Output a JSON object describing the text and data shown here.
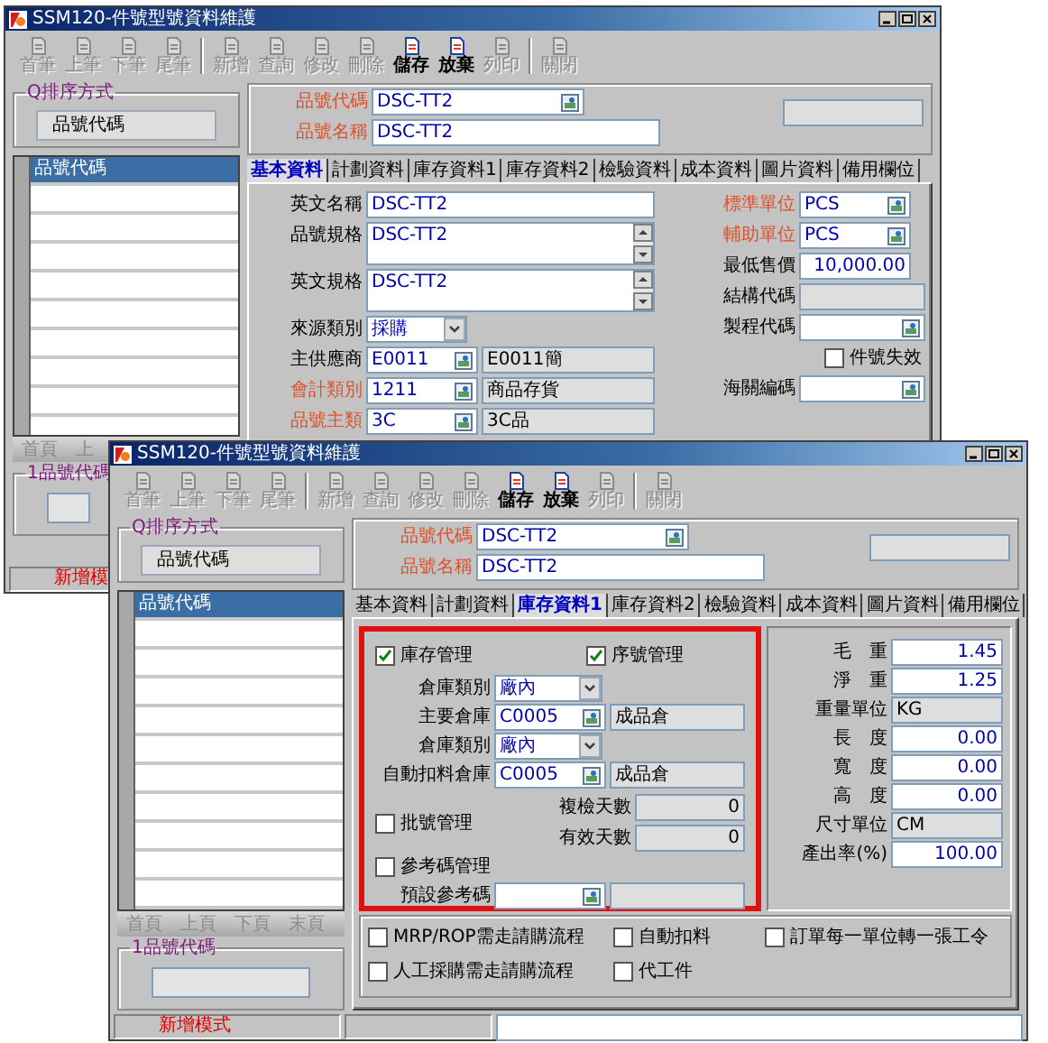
{
  "windows": [
    {
      "title": "SSM120-件號型號資料維護",
      "toolbar": [
        [
          {
            "label": "首筆",
            "disabled": true
          },
          {
            "label": "上筆",
            "disabled": true
          },
          {
            "label": "下筆",
            "disabled": true
          },
          {
            "label": "尾筆",
            "disabled": true
          }
        ],
        [
          {
            "label": "新增",
            "disabled": true
          },
          {
            "label": "查詢",
            "disabled": true
          },
          {
            "label": "修改",
            "disabled": true
          },
          {
            "label": "刪除",
            "disabled": true
          },
          {
            "label": "儲存",
            "disabled": false
          },
          {
            "label": "放棄",
            "disabled": false
          },
          {
            "label": "列印",
            "disabled": true
          }
        ],
        [
          {
            "label": "關閉",
            "disabled": true
          }
        ]
      ],
      "sort_group": {
        "title": "Q排序方式",
        "value": "品號代碼"
      },
      "list_header": "品號代碼",
      "nav": [
        {
          "label": "首頁",
          "disabled": true
        },
        {
          "label": "上",
          "disabled": true
        }
      ],
      "filter_group": {
        "title": "1品號代碼"
      },
      "status_bar": {
        "mode": "新增模"
      },
      "header_fields": [
        {
          "kind": "field",
          "label": "品號代碼",
          "required": true,
          "fields": [
            {
              "kind": "lookup",
              "value": "DSC-TT2"
            }
          ]
        },
        {
          "kind": "field",
          "label": "品號名稱",
          "required": true,
          "fields": [
            {
              "kind": "text",
              "value": "DSC-TT2"
            }
          ]
        }
      ],
      "tabs": [
        {
          "label": "基本資料",
          "selected": true
        },
        {
          "label": "計劃資料",
          "selected": false
        },
        {
          "label": "庫存資料1",
          "selected": false
        },
        {
          "label": "庫存資料2",
          "selected": false
        },
        {
          "label": "檢驗資料",
          "selected": false
        },
        {
          "label": "成本資料",
          "selected": false
        },
        {
          "label": "圖片資料",
          "selected": false
        },
        {
          "label": "備用欄位",
          "selected": false
        }
      ],
      "form": {
        "kind": "basic",
        "left": [
          {
            "kind": "field",
            "label": "英文名稱",
            "required": false,
            "fields": [
              {
                "kind": "text",
                "value": "DSC-TT2"
              }
            ]
          },
          {
            "kind": "field",
            "label": "品號規格",
            "required": false,
            "fields": [
              {
                "kind": "textarea",
                "value": "DSC-TT2"
              }
            ]
          },
          {
            "kind": "field",
            "label": "英文規格",
            "required": false,
            "fields": [
              {
                "kind": "textarea",
                "value": "DSC-TT2"
              }
            ]
          },
          {
            "kind": "field",
            "label": "來源類別",
            "required": false,
            "fields": [
              {
                "kind": "select",
                "value": "採購"
              }
            ]
          },
          {
            "kind": "field",
            "label": "主供應商",
            "required": false,
            "fields": [
              {
                "kind": "lookup",
                "value": "E0011"
              },
              {
                "kind": "readonly",
                "value": "E0011簡"
              }
            ]
          },
          {
            "kind": "field",
            "label": "會計類別",
            "required": true,
            "fields": [
              {
                "kind": "lookup",
                "value": "1211"
              },
              {
                "kind": "readonly",
                "value": "商品存貨"
              }
            ]
          },
          {
            "kind": "field",
            "label": "品號主類",
            "required": true,
            "fields": [
              {
                "kind": "lookup",
                "value": "3C"
              },
              {
                "kind": "readonly",
                "value": "3C品"
              }
            ]
          }
        ],
        "right": [
          {
            "kind": "field",
            "label": "標準單位",
            "required": true,
            "fields": [
              {
                "kind": "lookup",
                "value": "PCS"
              }
            ]
          },
          {
            "kind": "field",
            "label": "輔助單位",
            "required": true,
            "fields": [
              {
                "kind": "lookup",
                "value": "PCS"
              }
            ]
          },
          {
            "kind": "field",
            "label": "最低售價",
            "required": false,
            "fields": [
              {
                "kind": "number",
                "value": "10,000.00"
              }
            ]
          },
          {
            "kind": "field",
            "label": "結構代碼",
            "required": false,
            "fields": [
              {
                "kind": "readonly"
              }
            ]
          },
          {
            "kind": "field",
            "label": "製程代碼",
            "required": false,
            "fields": [
              {
                "kind": "lookup"
              }
            ]
          },
          {
            "kind": "checkbox",
            "label": "件號失效",
            "checked": false
          },
          {
            "kind": "field",
            "label": "海關編碼",
            "required": false,
            "fields": [
              {
                "kind": "lookup"
              }
            ]
          }
        ]
      }
    },
    {
      "title": "SSM120-件號型號資料維護",
      "toolbar": [
        [
          {
            "label": "首筆",
            "disabled": true
          },
          {
            "label": "上筆",
            "disabled": true
          },
          {
            "label": "下筆",
            "disabled": true
          },
          {
            "label": "尾筆",
            "disabled": true
          }
        ],
        [
          {
            "label": "新增",
            "disabled": true
          },
          {
            "label": "查詢",
            "disabled": true
          },
          {
            "label": "修改",
            "disabled": true
          },
          {
            "label": "刪除",
            "disabled": true
          },
          {
            "label": "儲存",
            "disabled": false
          },
          {
            "label": "放棄",
            "disabled": false
          },
          {
            "label": "列印",
            "disabled": true
          }
        ],
        [
          {
            "label": "關閉",
            "disabled": true
          }
        ]
      ],
      "sort_group": {
        "title": "Q排序方式",
        "value": "品號代碼"
      },
      "list_header": "品號代碼",
      "nav": [
        {
          "label": "首頁",
          "disabled": true
        },
        {
          "label": "上頁",
          "disabled": true
        },
        {
          "label": "下頁",
          "disabled": true
        },
        {
          "label": "末頁",
          "disabled": true
        }
      ],
      "filter_group": {
        "title": "1品號代碼"
      },
      "status_bar": {
        "mode": "新增模式"
      },
      "header_fields": [
        {
          "kind": "field",
          "label": "品號代碼",
          "required": true,
          "fields": [
            {
              "kind": "lookup",
              "value": "DSC-TT2"
            }
          ]
        },
        {
          "kind": "field",
          "label": "品號名稱",
          "required": true,
          "fields": [
            {
              "kind": "text",
              "value": "DSC-TT2"
            }
          ]
        }
      ],
      "tabs": [
        {
          "label": "基本資料",
          "selected": false
        },
        {
          "label": "計劃資料",
          "selected": false
        },
        {
          "label": "庫存資料1",
          "selected": true
        },
        {
          "label": "庫存資料2",
          "selected": false
        },
        {
          "label": "檢驗資料",
          "selected": false
        },
        {
          "label": "成本資料",
          "selected": false
        },
        {
          "label": "圖片資料",
          "selected": false
        },
        {
          "label": "備用欄位",
          "selected": false
        }
      ],
      "form": {
        "kind": "inventory",
        "inventory": {
          "checks": [
            {
              "label": "庫存管理",
              "checked": true
            },
            {
              "label": "序號管理",
              "checked": true
            }
          ],
          "rows": [
            {
              "kind": "field",
              "label": "倉庫類別",
              "fields": [
                {
                  "kind": "select",
                  "value": "廠內"
                }
              ]
            },
            {
              "kind": "field",
              "label": "主要倉庫",
              "fields": [
                {
                  "kind": "lookup",
                  "value": "C0005"
                },
                {
                  "kind": "readonly",
                  "value": "成品倉"
                }
              ]
            },
            {
              "kind": "field",
              "label": "倉庫類別",
              "fields": [
                {
                  "kind": "select",
                  "value": "廠內"
                }
              ]
            },
            {
              "kind": "field",
              "label": "自動扣料倉庫",
              "fields": [
                {
                  "kind": "lookup",
                  "value": "C0005"
                },
                {
                  "kind": "readonly",
                  "value": "成品倉"
                }
              ]
            }
          ],
          "lot": {
            "label": "批號管理",
            "checked": false
          },
          "days": [
            {
              "kind": "field",
              "label": "複檢天數",
              "fields": [
                {
                  "kind": "readonly_number",
                  "value": "0"
                }
              ]
            },
            {
              "kind": "field",
              "label": "有效天數",
              "fields": [
                {
                  "kind": "readonly_number",
                  "value": "0"
                }
              ]
            }
          ],
          "ref": {
            "label": "參考碼管理",
            "checked": false
          },
          "ref_row": {
            "kind": "field",
            "label": "預設參考碼",
            "fields": [
              {
                "kind": "lookup"
              },
              {
                "kind": "readonly"
              }
            ]
          }
        },
        "measures": [
          {
            "kind": "field",
            "label": "毛　重",
            "fields": [
              {
                "kind": "number",
                "value": "1.45"
              }
            ]
          },
          {
            "kind": "field",
            "label": "淨　重",
            "fields": [
              {
                "kind": "number",
                "value": "1.25"
              }
            ]
          },
          {
            "kind": "field",
            "label": "重量單位",
            "fields": [
              {
                "kind": "readonly",
                "value": "KG"
              }
            ]
          },
          {
            "kind": "field",
            "label": "長　度",
            "fields": [
              {
                "kind": "number",
                "value": "0.00"
              }
            ]
          },
          {
            "kind": "field",
            "label": "寬　度",
            "fields": [
              {
                "kind": "number",
                "value": "0.00"
              }
            ]
          },
          {
            "kind": "field",
            "label": "高　度",
            "fields": [
              {
                "kind": "number",
                "value": "0.00"
              }
            ]
          },
          {
            "kind": "field",
            "label": "尺寸單位",
            "fields": [
              {
                "kind": "readonly",
                "value": "CM"
              }
            ]
          },
          {
            "kind": "field",
            "label": "產出率(%)",
            "fields": [
              {
                "kind": "number",
                "value": "100.00"
              }
            ]
          }
        ],
        "options": [
          {
            "label": "MRP/ROP需走請購流程",
            "checked": false
          },
          {
            "label": "自動扣料",
            "checked": false
          },
          {
            "label": "訂單每一單位轉一張工令",
            "checked": false
          },
          {
            "label": "人工採購需走請購流程",
            "checked": false
          },
          {
            "label": "代工件",
            "checked": false
          }
        ]
      }
    }
  ]
}
